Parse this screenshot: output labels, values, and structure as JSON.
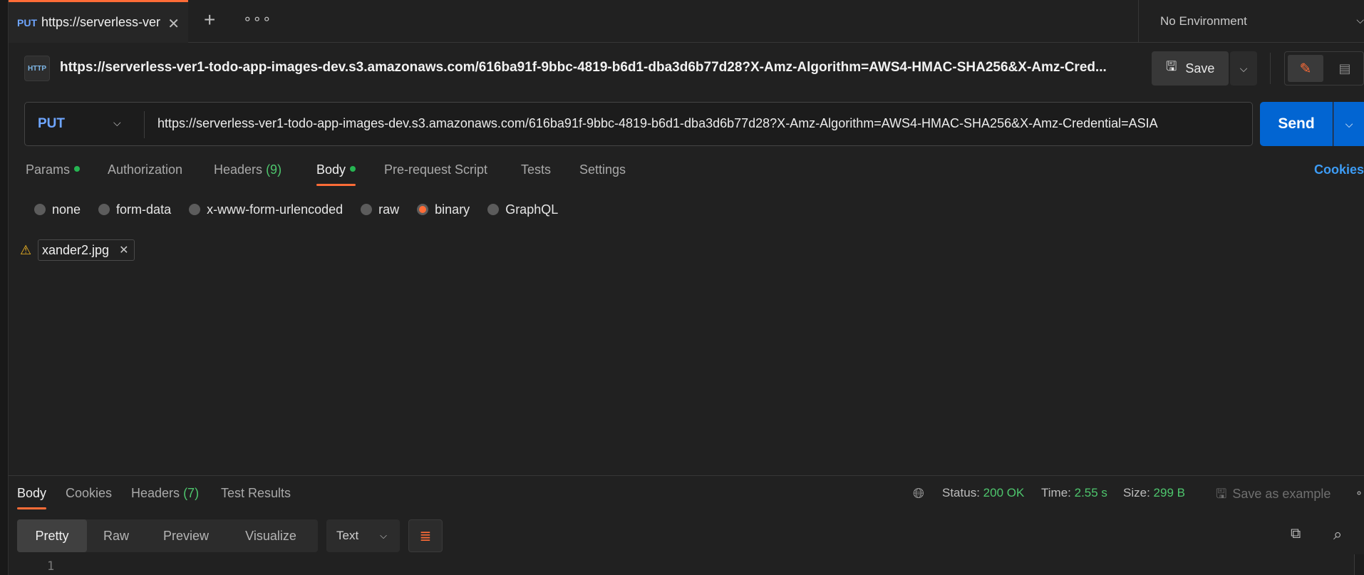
{
  "tab": {
    "method": "PUT",
    "title": "https://serverless-ver",
    "close_icon": "close-icon"
  },
  "tabbar": {
    "new_tab_icon": "plus-icon",
    "more_icon": "more-horizontal-icon"
  },
  "environment": {
    "label": "No Environment"
  },
  "request": {
    "http_badge": "HTTP",
    "title_url": "https://serverless-ver1-todo-app-images-dev.s3.amazonaws.com/616ba91f-9bbc-4819-b6d1-dba3d6b77d28?X-Amz-Algorithm=AWS4-HMAC-SHA256&X-Amz-Cred...",
    "method": "PUT",
    "url": "https://serverless-ver1-todo-app-images-dev.s3.amazonaws.com/616ba91f-9bbc-4819-b6d1-dba3d6b77d28?X-Amz-Algorithm=AWS4-HMAC-SHA256&X-Amz-Credential=ASIA",
    "save_label": "Save",
    "send_label": "Send"
  },
  "request_tabs": [
    {
      "label": "Params",
      "dot": true
    },
    {
      "label": "Authorization"
    },
    {
      "label": "Headers",
      "count": "(9)"
    },
    {
      "label": "Body",
      "dot": true,
      "active": true
    },
    {
      "label": "Pre-request Script"
    },
    {
      "label": "Tests"
    },
    {
      "label": "Settings"
    }
  ],
  "cookies_link": "Cookies",
  "body_modes": {
    "options": [
      "none",
      "form-data",
      "x-www-form-urlencoded",
      "raw",
      "binary",
      "GraphQL"
    ],
    "selected": "binary"
  },
  "file": {
    "name": "xander2.jpg",
    "warning_icon": "warning-icon"
  },
  "response": {
    "tabs": [
      {
        "label": "Body",
        "active": true
      },
      {
        "label": "Cookies"
      },
      {
        "label": "Headers",
        "count": "(7)"
      },
      {
        "label": "Test Results"
      }
    ],
    "status_label": "Status:",
    "status_value": "200 OK",
    "time_label": "Time:",
    "time_value": "2.55 s",
    "size_label": "Size:",
    "size_value": "299 B",
    "save_example_label": "Save as example",
    "formats": [
      "Pretty",
      "Raw",
      "Preview",
      "Visualize"
    ],
    "active_format": "Pretty",
    "type": "Text",
    "line_number": "1"
  },
  "colors": {
    "accent": "#ff6c37",
    "send": "#0265d2",
    "success": "#4ec66d",
    "method": "#6ea5ff"
  }
}
